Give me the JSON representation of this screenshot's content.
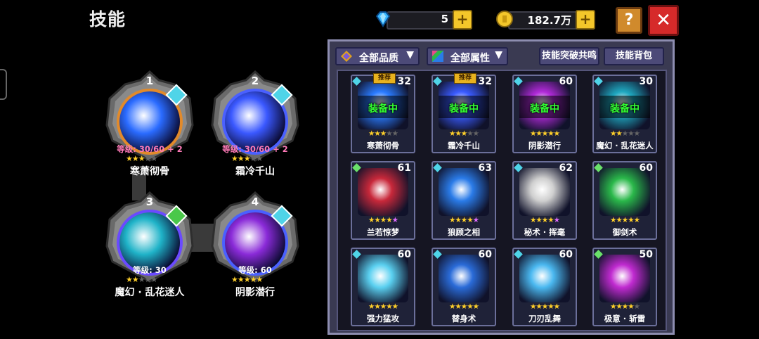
{
  "header": {
    "title": "技能"
  },
  "currency": {
    "gems": {
      "value": "5",
      "icon": "diamond-icon"
    },
    "gold": {
      "value": "182.7万",
      "icon": "coin-icon"
    }
  },
  "buttons": {
    "help": "?",
    "close": "✕"
  },
  "equipped": [
    {
      "slot": "1",
      "name": "寒萧彻骨",
      "level": "等级: 30/60 + 2",
      "stars": 3,
      "max_stars": 5,
      "orb_color": "#2a6bff",
      "ring": "#e28a2a"
    },
    {
      "slot": "2",
      "name": "霜冷千山",
      "level": "等级: 30/60 + 2",
      "stars": 3,
      "max_stars": 5,
      "orb_color": "#3a58ff",
      "ring": "#4a60ff"
    },
    {
      "slot": "3",
      "name": "魔幻 · 乱花迷人",
      "level": "等级: 30",
      "stars": 2,
      "max_stars": 5,
      "orb_color": "#1fb3c8",
      "ring": "#6a4aff"
    },
    {
      "slot": "4",
      "name": "阴影潜行",
      "level": "等级: 60",
      "stars": 5,
      "max_stars": 5,
      "orb_color": "#8a2ad8",
      "ring": "#4a60ff"
    }
  ],
  "panel": {
    "quality_filter": "全部品质",
    "attribute_filter": "全部属性",
    "breakthrough_button": "技能突破共鸣",
    "bag_button": "技能背包",
    "equipped_label": "装备中",
    "recommend_label": "推荐"
  },
  "skills": [
    {
      "name": "寒萧彻骨",
      "level": "32",
      "stars": 3,
      "max_stars": 5,
      "equipped": true,
      "recommended": true,
      "color": "#2a7bff",
      "badge_color": "#4fd4e8"
    },
    {
      "name": "霜冷千山",
      "level": "32",
      "stars": 3,
      "max_stars": 5,
      "equipped": true,
      "recommended": true,
      "color": "#3a5bff",
      "badge_color": "#4fd4e8"
    },
    {
      "name": "阴影潜行",
      "level": "60",
      "stars": 5,
      "max_stars": 5,
      "equipped": true,
      "recommended": false,
      "color": "#b02ad8",
      "badge_color": "#4fd4e8"
    },
    {
      "name": "魔幻 · 乱花迷人",
      "level": "30",
      "stars": 2,
      "max_stars": 5,
      "equipped": true,
      "recommended": false,
      "color": "#1fa8c0",
      "badge_color": "#4fd4e8"
    },
    {
      "name": "兰若惊梦",
      "level": "61",
      "stars": 4,
      "max_stars": 5,
      "equipped": false,
      "recommended": false,
      "color": "#c8283a",
      "badge_color": "#6ae06a",
      "purple_stars": 1
    },
    {
      "name": "狼顾之相",
      "level": "63",
      "stars": 4,
      "max_stars": 5,
      "equipped": false,
      "recommended": false,
      "color": "#2a7be8",
      "badge_color": "#4fd4e8",
      "purple_stars": 1
    },
    {
      "name": "秘术 · 挥毫",
      "level": "62",
      "stars": 4,
      "max_stars": 5,
      "equipped": false,
      "recommended": false,
      "color": "#cfcfcf",
      "badge_color": "#4fd4e8",
      "purple_stars": 1
    },
    {
      "name": "御剑术",
      "level": "60",
      "stars": 5,
      "max_stars": 5,
      "equipped": false,
      "recommended": false,
      "color": "#2ab84a",
      "badge_color": "#6ae06a"
    },
    {
      "name": "强力猛攻",
      "level": "60",
      "stars": 5,
      "max_stars": 5,
      "equipped": false,
      "recommended": false,
      "color": "#5ad0f0",
      "badge_color": "#4fd4e8"
    },
    {
      "name": "替身术",
      "level": "60",
      "stars": 5,
      "max_stars": 5,
      "equipped": false,
      "recommended": false,
      "color": "#2a6bd8",
      "badge_color": "#4fd4e8"
    },
    {
      "name": "刀刃乱舞",
      "level": "60",
      "stars": 5,
      "max_stars": 5,
      "equipped": false,
      "recommended": false,
      "color": "#4ab8f0",
      "badge_color": "#4fd4e8"
    },
    {
      "name": "极意 · 斩雷",
      "level": "50",
      "stars": 4,
      "max_stars": 5,
      "equipped": false,
      "recommended": false,
      "color": "#c02ad0",
      "badge_color": "#6ae06a"
    }
  ]
}
